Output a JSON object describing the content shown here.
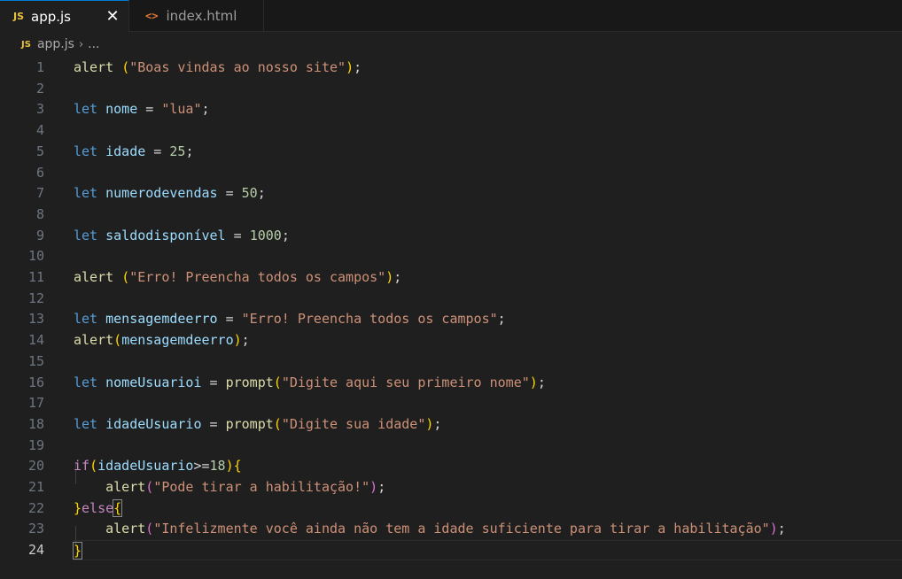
{
  "tabs": [
    {
      "icon": "JS",
      "label": "app.js",
      "active": true,
      "close": "✕"
    },
    {
      "icon": "<>",
      "label": "index.html",
      "active": false
    }
  ],
  "breadcrumb": {
    "icon": "JS",
    "file": "app.js",
    "separator": "›",
    "more": "..."
  },
  "editor": {
    "current_line": 24,
    "lines": [
      {
        "n": "1",
        "tokens": [
          [
            "func",
            "alert"
          ],
          [
            "punc",
            " "
          ],
          [
            "b1",
            "("
          ],
          [
            "str",
            "\"Boas vindas ao nosso site\""
          ],
          [
            "b1",
            ")"
          ],
          [
            "punc",
            ";"
          ]
        ]
      },
      {
        "n": "2",
        "tokens": []
      },
      {
        "n": "3",
        "tokens": [
          [
            "keyword",
            "let"
          ],
          [
            "punc",
            " "
          ],
          [
            "var",
            "nome"
          ],
          [
            "op",
            " = "
          ],
          [
            "str",
            "\"lua\""
          ],
          [
            "punc",
            ";"
          ]
        ]
      },
      {
        "n": "4",
        "tokens": []
      },
      {
        "n": "5",
        "tokens": [
          [
            "keyword",
            "let"
          ],
          [
            "punc",
            " "
          ],
          [
            "var",
            "idade"
          ],
          [
            "op",
            " = "
          ],
          [
            "num",
            "25"
          ],
          [
            "punc",
            ";"
          ]
        ]
      },
      {
        "n": "6",
        "tokens": []
      },
      {
        "n": "7",
        "tokens": [
          [
            "keyword",
            "let"
          ],
          [
            "punc",
            " "
          ],
          [
            "var",
            "numerodevendas"
          ],
          [
            "op",
            " = "
          ],
          [
            "num",
            "50"
          ],
          [
            "punc",
            ";"
          ]
        ]
      },
      {
        "n": "8",
        "tokens": []
      },
      {
        "n": "9",
        "tokens": [
          [
            "keyword",
            "let"
          ],
          [
            "punc",
            " "
          ],
          [
            "var",
            "saldodisponível"
          ],
          [
            "op",
            " = "
          ],
          [
            "num",
            "1000"
          ],
          [
            "punc",
            ";"
          ]
        ]
      },
      {
        "n": "10",
        "tokens": []
      },
      {
        "n": "11",
        "tokens": [
          [
            "func",
            "alert"
          ],
          [
            "punc",
            " "
          ],
          [
            "b1",
            "("
          ],
          [
            "str",
            "\"Erro! Preencha todos os campos\""
          ],
          [
            "b1",
            ")"
          ],
          [
            "punc",
            ";"
          ]
        ]
      },
      {
        "n": "12",
        "tokens": []
      },
      {
        "n": "13",
        "tokens": [
          [
            "keyword",
            "let"
          ],
          [
            "punc",
            " "
          ],
          [
            "var",
            "mensagemdeerro"
          ],
          [
            "op",
            " = "
          ],
          [
            "str",
            "\"Erro! Preencha todos os campos\""
          ],
          [
            "punc",
            ";"
          ]
        ]
      },
      {
        "n": "14",
        "tokens": [
          [
            "func",
            "alert"
          ],
          [
            "b1",
            "("
          ],
          [
            "var",
            "mensagemdeerro"
          ],
          [
            "b1",
            ")"
          ],
          [
            "punc",
            ";"
          ]
        ]
      },
      {
        "n": "15",
        "tokens": []
      },
      {
        "n": "16",
        "tokens": [
          [
            "keyword",
            "let"
          ],
          [
            "punc",
            " "
          ],
          [
            "var",
            "nomeUsuarioi"
          ],
          [
            "op",
            " = "
          ],
          [
            "func",
            "prompt"
          ],
          [
            "b1",
            "("
          ],
          [
            "str",
            "\"Digite aqui seu primeiro nome\""
          ],
          [
            "b1",
            ")"
          ],
          [
            "punc",
            ";"
          ]
        ]
      },
      {
        "n": "17",
        "tokens": []
      },
      {
        "n": "18",
        "tokens": [
          [
            "keyword",
            "let"
          ],
          [
            "punc",
            " "
          ],
          [
            "var",
            "idadeUsuario"
          ],
          [
            "op",
            " = "
          ],
          [
            "func",
            "prompt"
          ],
          [
            "b1",
            "("
          ],
          [
            "str",
            "\"Digite sua idade\""
          ],
          [
            "b1",
            ")"
          ],
          [
            "punc",
            ";"
          ]
        ]
      },
      {
        "n": "19",
        "tokens": []
      },
      {
        "n": "20",
        "tokens": [
          [
            "control",
            "if"
          ],
          [
            "b1",
            "("
          ],
          [
            "var",
            "idadeUsuario"
          ],
          [
            "op",
            ">="
          ],
          [
            "num",
            "18"
          ],
          [
            "b1",
            ")"
          ],
          [
            "b1",
            "{"
          ]
        ]
      },
      {
        "n": "21",
        "tokens": [
          [
            "punc",
            "    "
          ],
          [
            "func",
            "alert"
          ],
          [
            "b2",
            "("
          ],
          [
            "str",
            "\"Pode tirar a habilitação!\""
          ],
          [
            "b2",
            ")"
          ],
          [
            "punc",
            ";"
          ]
        ]
      },
      {
        "n": "22",
        "tokens": [
          [
            "b1",
            "}"
          ],
          [
            "control",
            "else"
          ],
          [
            "b1m",
            "{"
          ]
        ]
      },
      {
        "n": "23",
        "tokens": [
          [
            "punc",
            "    "
          ],
          [
            "func",
            "alert"
          ],
          [
            "b2",
            "("
          ],
          [
            "str",
            "\"Infelizmente você ainda não tem a idade suficiente para tirar a habilitação\""
          ],
          [
            "b2",
            ")"
          ],
          [
            "punc",
            ";"
          ]
        ]
      },
      {
        "n": "24",
        "tokens": [
          [
            "b1m",
            "}"
          ]
        ]
      }
    ]
  },
  "colors": {
    "background": "#1f1f1f",
    "tabbar": "#181818",
    "accent": "#0078d4",
    "keyword": "#569cd6",
    "control": "#c586c0",
    "variable": "#9cdcfe",
    "function": "#dcdcaa",
    "string": "#ce9178",
    "number": "#b5cea8"
  }
}
